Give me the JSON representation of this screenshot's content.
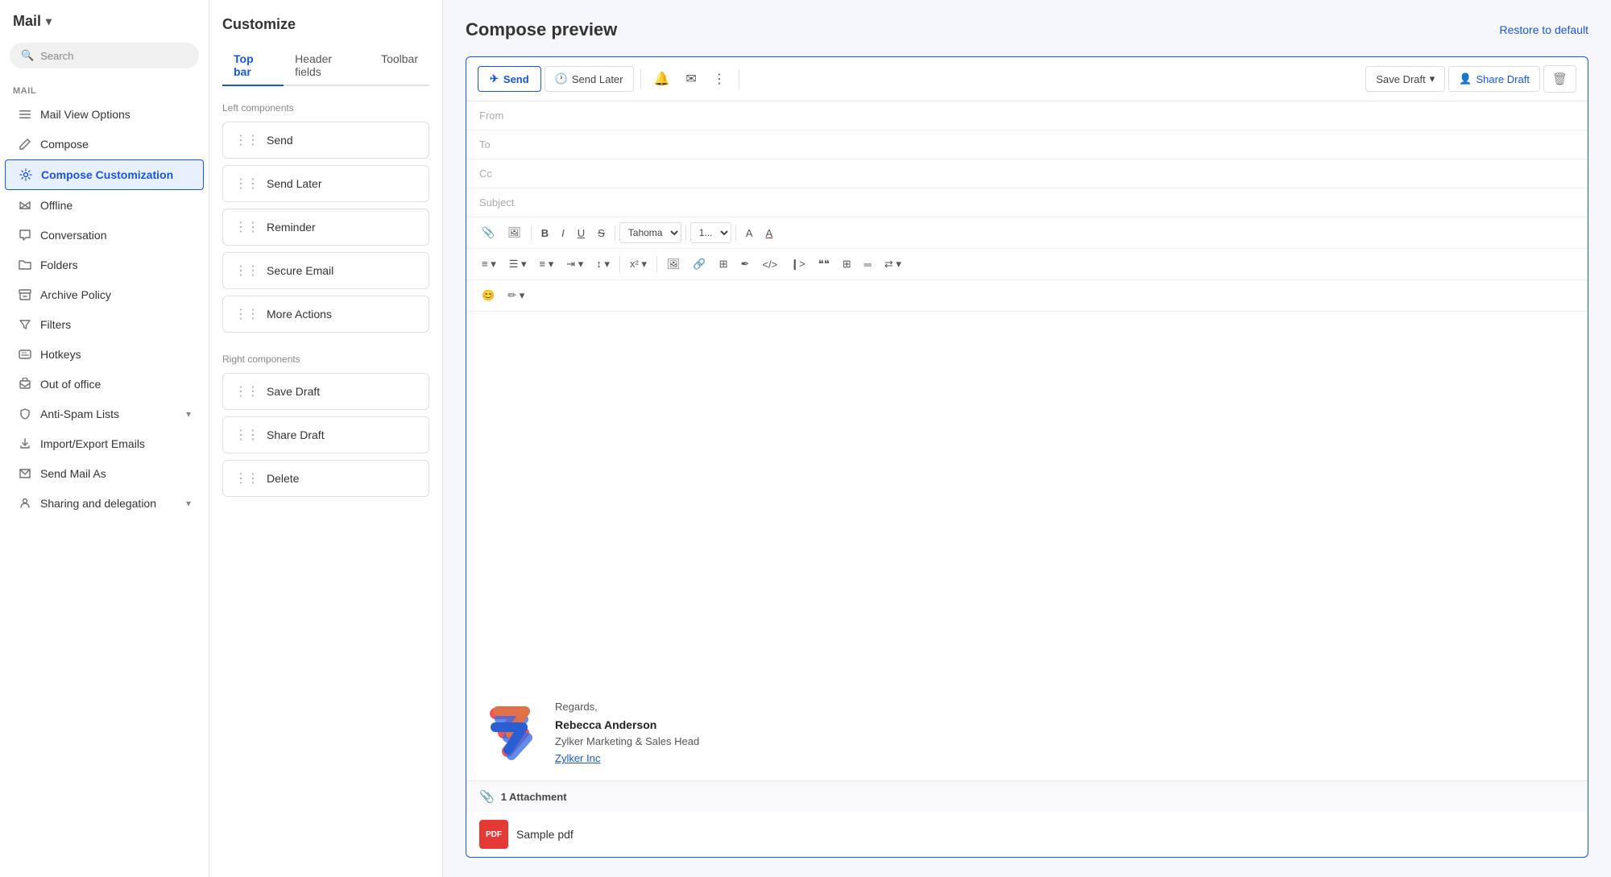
{
  "app": {
    "title": "Mail",
    "chevron": "▾"
  },
  "search": {
    "placeholder": "Search",
    "icon": "🔍"
  },
  "sidebar": {
    "section_label": "MAIL",
    "items": [
      {
        "id": "mail-view-options",
        "label": "Mail View Options",
        "icon": "☰",
        "active": false
      },
      {
        "id": "compose",
        "label": "Compose",
        "icon": "✏️",
        "active": false
      },
      {
        "id": "compose-customization",
        "label": "Compose Customization",
        "icon": "⚙",
        "active": true
      },
      {
        "id": "offline",
        "label": "Offline",
        "icon": "📡",
        "active": false
      },
      {
        "id": "conversation",
        "label": "Conversation",
        "icon": "💬",
        "active": false
      },
      {
        "id": "folders",
        "label": "Folders",
        "icon": "📁",
        "active": false
      },
      {
        "id": "archive-policy",
        "label": "Archive Policy",
        "icon": "📥",
        "active": false
      },
      {
        "id": "filters",
        "label": "Filters",
        "icon": "🔽",
        "active": false
      },
      {
        "id": "hotkeys",
        "label": "Hotkeys",
        "icon": "⌨",
        "active": false
      },
      {
        "id": "out-of-office",
        "label": "Out of office",
        "icon": "🏖",
        "active": false
      },
      {
        "id": "anti-spam",
        "label": "Anti-Spam Lists",
        "icon": "🛡",
        "active": false,
        "has_chevron": true
      },
      {
        "id": "import-export",
        "label": "Import/Export Emails",
        "icon": "📤",
        "active": false
      },
      {
        "id": "send-mail-as",
        "label": "Send Mail As",
        "icon": "✉",
        "active": false
      },
      {
        "id": "sharing-delegation",
        "label": "Sharing and delegation",
        "icon": "🤝",
        "active": false,
        "has_chevron": true
      }
    ]
  },
  "customize": {
    "title": "Customize",
    "tabs": [
      {
        "id": "top-bar",
        "label": "Top bar",
        "active": true
      },
      {
        "id": "header-fields",
        "label": "Header fields",
        "active": false
      },
      {
        "id": "toolbar",
        "label": "Toolbar",
        "active": false
      }
    ],
    "left_components_label": "Left components",
    "left_items": [
      {
        "id": "send",
        "label": "Send"
      },
      {
        "id": "send-later",
        "label": "Send Later"
      },
      {
        "id": "reminder",
        "label": "Reminder"
      },
      {
        "id": "secure-email",
        "label": "Secure Email"
      },
      {
        "id": "more-actions",
        "label": "More Actions"
      }
    ],
    "right_components_label": "Right components",
    "right_items": [
      {
        "id": "save-draft",
        "label": "Save Draft"
      },
      {
        "id": "share-draft",
        "label": "Share Draft"
      },
      {
        "id": "delete",
        "label": "Delete"
      }
    ]
  },
  "preview": {
    "title": "Compose preview",
    "restore_label": "Restore to default",
    "toolbar": {
      "send_label": "Send",
      "send_later_label": "Send Later",
      "save_draft_label": "Save Draft",
      "share_draft_label": "Share Draft"
    },
    "fields": {
      "from": "From",
      "to": "To",
      "cc": "Cc",
      "subject": "Subject"
    },
    "format_bar": {
      "font": "Tahoma",
      "size": "1..."
    },
    "signature": {
      "regards": "Regards,",
      "name": "Rebecca Anderson",
      "title": "Zylker Marketing & Sales Head",
      "company_link": "Zylker Inc"
    },
    "attachment": {
      "label": "1 Attachment",
      "sample_name": "Sample pdf"
    }
  }
}
